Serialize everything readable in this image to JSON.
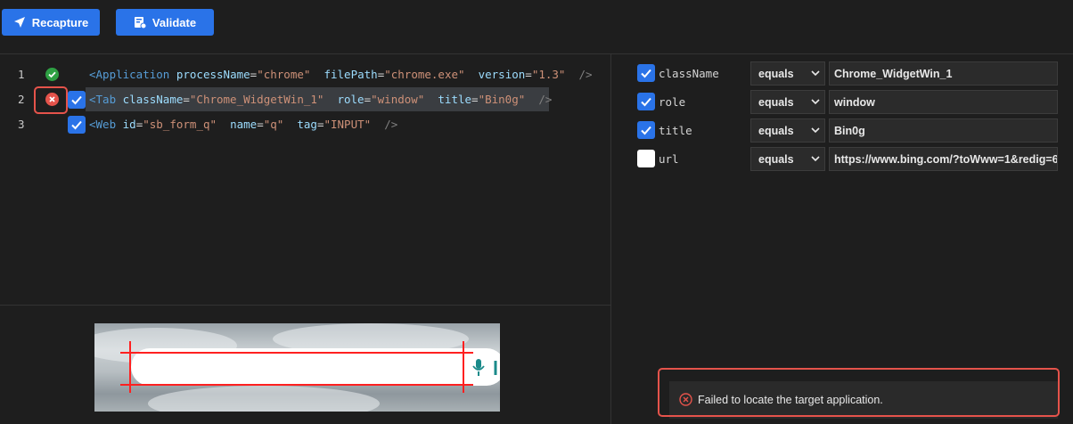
{
  "toolbar": {
    "recapture_label": "Recapture",
    "validate_label": "Validate",
    "accent_color": "#2a73e8"
  },
  "selector_lines": [
    {
      "number": "1",
      "status": "ok",
      "checked": null,
      "tag": "Application",
      "attrs": [
        {
          "name": "processName",
          "value": "\"chrome\""
        },
        {
          "name": "filePath",
          "value": "\"chrome.exe\""
        },
        {
          "name": "version",
          "value": "\"1.3\""
        }
      ]
    },
    {
      "number": "2",
      "status": "error",
      "checked": true,
      "tag": "Tab",
      "attrs": [
        {
          "name": "className",
          "value": "\"Chrome_WidgetWin_1\""
        },
        {
          "name": "role",
          "value": "\"window\""
        },
        {
          "name": "title",
          "value": "\"Bin0g\""
        }
      ]
    },
    {
      "number": "3",
      "status": null,
      "checked": true,
      "tag": "Web",
      "attrs": [
        {
          "name": "id",
          "value": "\"sb_form_q\""
        },
        {
          "name": "name",
          "value": "\"q\""
        },
        {
          "name": "tag",
          "value": "\"INPUT\""
        }
      ]
    }
  ],
  "syntax": {
    "open": "<",
    "close": "/>",
    "eq": "="
  },
  "properties": [
    {
      "checked": true,
      "name": "className",
      "operator": "equals",
      "value": "Chrome_WidgetWin_1"
    },
    {
      "checked": true,
      "name": "role",
      "operator": "equals",
      "value": "window"
    },
    {
      "checked": true,
      "name": "title",
      "operator": "equals",
      "value": "Bin0g"
    },
    {
      "checked": false,
      "name": "url",
      "operator": "equals",
      "value": "https://www.bing.com/?toWww=1&redig=6"
    }
  ],
  "error_message": "Failed to locate the target application.",
  "colors": {
    "error": "#e5534b",
    "ok": "#2ea043",
    "target_outline": "#ff2020"
  },
  "icons": {
    "recapture": "send-arrow-icon",
    "validate": "validate-icon",
    "ok": "check-circle-icon",
    "error": "x-circle-icon",
    "mic": "microphone-icon",
    "dropdown": "chevron-down-icon"
  }
}
